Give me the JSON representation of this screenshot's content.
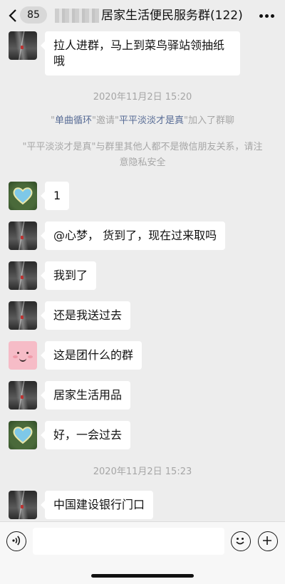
{
  "header": {
    "unread_count": "85",
    "title": "居家生活便民服务群(122)"
  },
  "messages": [
    {
      "text": "拉人进群，马上到菜鸟驿站领抽纸哦"
    },
    {
      "text": "1"
    },
    {
      "text": "@心梦， 货到了，现在过来取吗"
    },
    {
      "text": "我到了"
    },
    {
      "text": "还是我送过去"
    },
    {
      "text": "这是团什么的群"
    },
    {
      "text": "居家生活用品"
    },
    {
      "text": "好，一会过去"
    },
    {
      "text": "中国建设银行门口"
    }
  ],
  "timestamps": [
    "2020年11月2日 15:20",
    "2020年11月2日 15:23"
  ],
  "system": {
    "join": {
      "q1": "\"",
      "inviter": "单曲循环",
      "q2": "\"邀请\"",
      "invitee": "平平淡淡才是真",
      "q3": "\"加入了群聊"
    },
    "notice": {
      "q1": "\"",
      "name": "平平淡淡才是真",
      "rest": "\"与群里其他人都不是微信朋友关系，请注意隐私安全"
    }
  },
  "colors": {
    "background": "#ededed",
    "link": "#576b95",
    "bubble": "#ffffff"
  },
  "icons": [
    "back-icon",
    "more-icon",
    "voice-icon",
    "emoji-icon",
    "plus-icon"
  ]
}
